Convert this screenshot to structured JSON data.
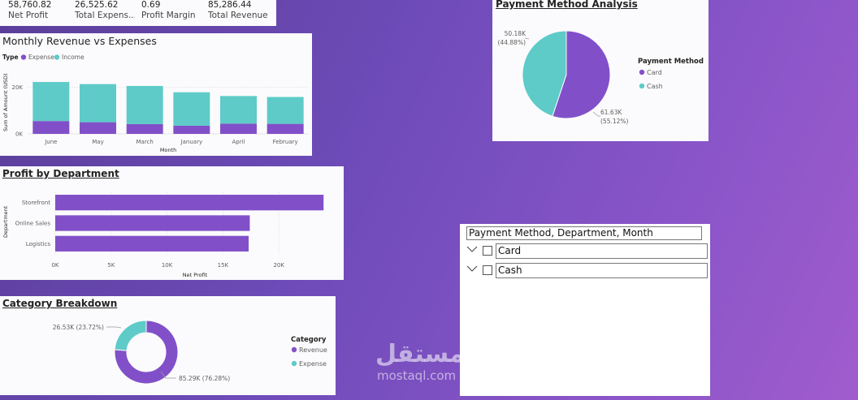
{
  "kpis": [
    {
      "value": "58,760.82",
      "label": "Net Profit"
    },
    {
      "value": "26,525.62",
      "label": "Total Expens..."
    },
    {
      "value": "0.69",
      "label": "Profit Margin"
    },
    {
      "value": "85,286.44",
      "label": "Total Revenue"
    }
  ],
  "monthly": {
    "title": "Monthly Revenue vs Expenses",
    "legend_title": "Type",
    "colors": {
      "expense": "#8150c9",
      "income": "#5ecbc8"
    },
    "chart_data": {
      "type": "bar",
      "stacked": true,
      "categories": [
        "June",
        "May",
        "March",
        "January",
        "April",
        "February"
      ],
      "series": [
        {
          "name": "Expense",
          "values": [
            5500,
            5000,
            4200,
            3500,
            4400,
            4300
          ]
        },
        {
          "name": "Income",
          "values": [
            16700,
            16300,
            16300,
            14300,
            11800,
            11500
          ]
        }
      ],
      "xlabel": "Month",
      "ylabel": "Sum of Amount (USD)",
      "yticks": [
        "0K",
        "20K"
      ],
      "ylim": [
        0,
        25000
      ],
      "legend_position": "top-left"
    }
  },
  "dept": {
    "title": "Profit by Department",
    "bar_color": "#8150c9",
    "chart_data": {
      "type": "bar",
      "orientation": "horizontal",
      "categories": [
        "Storefront",
        "Online Sales",
        "Logistics"
      ],
      "values": [
        24000,
        17400,
        17300
      ],
      "xlabel": "Net Profit",
      "ylabel": "Department",
      "xticks": [
        "0K",
        "5K",
        "10K",
        "15K",
        "20K"
      ],
      "xlim": [
        0,
        25000
      ]
    }
  },
  "category": {
    "title": "Category Breakdown",
    "legend_title": "Category",
    "colors": [
      "#8150c9",
      "#5ecbc8"
    ],
    "chart_data": {
      "type": "pie",
      "donut": true,
      "labels": [
        "Revenue",
        "Expense"
      ],
      "values": [
        85.29,
        26.53
      ],
      "data_labels": [
        "85.29K (76.28%)",
        "26.53K (23.72%)"
      ],
      "legend_position": "right"
    }
  },
  "payment": {
    "title": "Payment Method Analysis",
    "legend_title": "Payment Method",
    "colors": [
      "#8150c9",
      "#5ecbc8"
    ],
    "chart_data": {
      "type": "pie",
      "labels": [
        "Card",
        "Cash"
      ],
      "values": [
        61.63,
        50.18
      ],
      "data_labels": [
        [
          "61.63K",
          "(55.12%)"
        ],
        [
          "50.18K",
          "(44.88%)"
        ]
      ],
      "legend_position": "right"
    }
  },
  "slicer": {
    "header": "Payment Method, Department, Month",
    "items": [
      "Card",
      "Cash"
    ]
  },
  "watermark": {
    "arabic": "مستقل",
    "latin": "mostaql.com"
  }
}
